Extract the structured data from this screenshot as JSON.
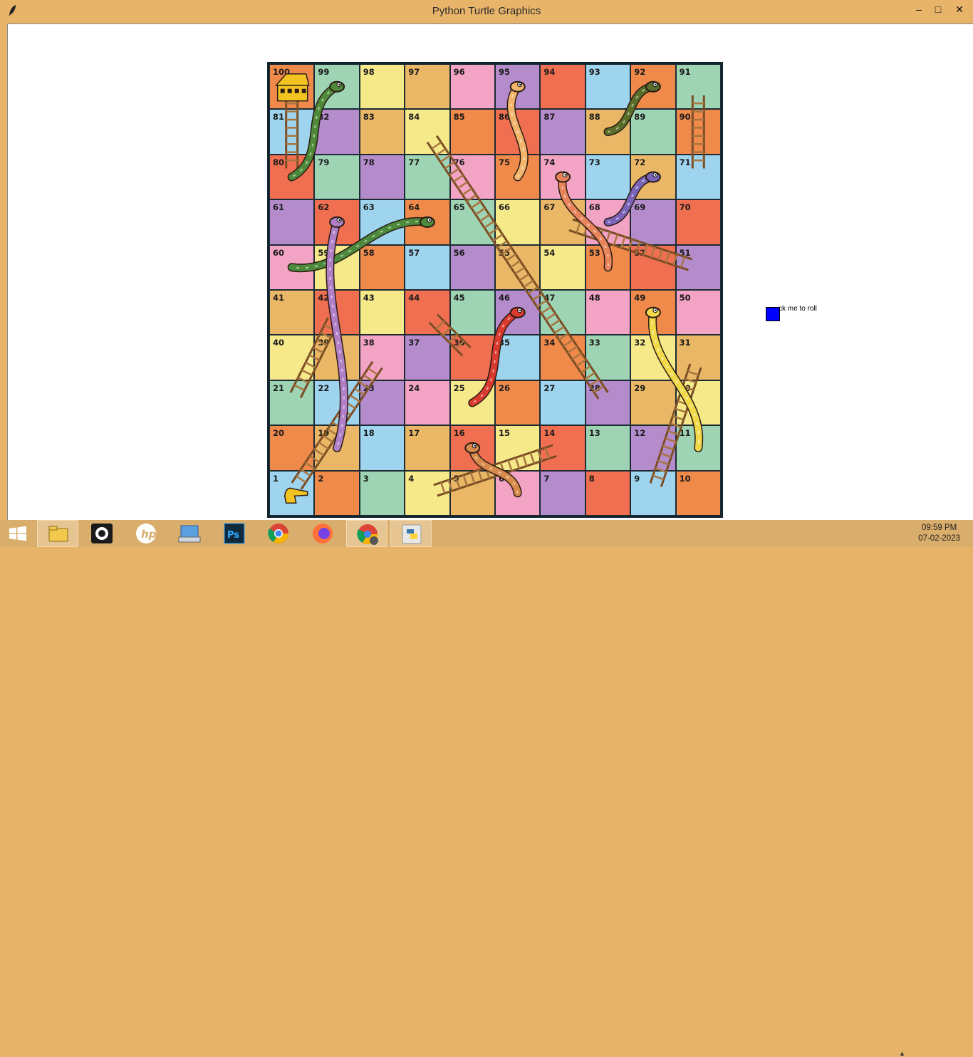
{
  "window": {
    "title": "Python Turtle Graphics",
    "minimize_glyph": "–",
    "maximize_glyph": "□",
    "close_glyph": "✕"
  },
  "roll_button": {
    "label": "ck me to roll",
    "color": "#0000ff"
  },
  "board": {
    "rows": [
      [
        100,
        99,
        98,
        97,
        96,
        95,
        94,
        93,
        92,
        91
      ],
      [
        81,
        82,
        83,
        84,
        85,
        86,
        87,
        88,
        89,
        90
      ],
      [
        80,
        79,
        78,
        77,
        76,
        75,
        74,
        73,
        72,
        71
      ],
      [
        61,
        62,
        63,
        64,
        65,
        66,
        67,
        68,
        69,
        70
      ],
      [
        60,
        59,
        58,
        57,
        56,
        55,
        54,
        53,
        52,
        51
      ],
      [
        41,
        42,
        43,
        44,
        45,
        46,
        47,
        48,
        49,
        50
      ],
      [
        40,
        39,
        38,
        37,
        36,
        35,
        34,
        33,
        32,
        31
      ],
      [
        21,
        22,
        23,
        24,
        25,
        26,
        27,
        28,
        29,
        30
      ],
      [
        20,
        19,
        18,
        17,
        16,
        15,
        14,
        13,
        12,
        11
      ],
      [
        1,
        2,
        3,
        4,
        5,
        6,
        7,
        8,
        9,
        10
      ]
    ],
    "palette": [
      "#f08a4b",
      "#b48ccc",
      "#f6e98a",
      "#9fd4ef",
      "#f3a3c3",
      "#9ed4b4",
      "#f06f50",
      "#e9b766"
    ],
    "ladders": [
      {
        "from": 1,
        "to": 38
      },
      {
        "from": 4,
        "to": 14
      },
      {
        "from": 9,
        "to": 31
      },
      {
        "from": 21,
        "to": 42
      },
      {
        "from": 28,
        "to": 84
      },
      {
        "from": 36,
        "to": 44
      },
      {
        "from": 51,
        "to": 67
      },
      {
        "from": 71,
        "to": 91
      },
      {
        "from": 80,
        "to": 100
      }
    ],
    "snakes": [
      {
        "head": 99,
        "tail": 80,
        "color": "#4f8a3a"
      },
      {
        "head": 95,
        "tail": 75,
        "color": "#f3b46b"
      },
      {
        "head": 92,
        "tail": 88,
        "color": "#5a6e2a"
      },
      {
        "head": 74,
        "tail": 53,
        "color": "#e8845a"
      },
      {
        "head": 72,
        "tail": 68,
        "color": "#7b64b8"
      },
      {
        "head": 64,
        "tail": 60,
        "color": "#4d8a3c"
      },
      {
        "head": 62,
        "tail": 19,
        "color": "#b07fc6"
      },
      {
        "head": 46,
        "tail": 25,
        "color": "#d83a2e"
      },
      {
        "head": 49,
        "tail": 11,
        "color": "#f1d94a"
      },
      {
        "head": 16,
        "tail": 6,
        "color": "#d78a4a"
      }
    ]
  },
  "player": {
    "position": 1,
    "color": "#ff0000"
  },
  "taskbar": {
    "apps": [
      {
        "name": "file-explorer-icon"
      },
      {
        "name": "camera-app-icon"
      },
      {
        "name": "hp-icon"
      },
      {
        "name": "keyboard-icon"
      },
      {
        "name": "photoshop-icon"
      },
      {
        "name": "chrome-icon"
      },
      {
        "name": "firefox-icon"
      },
      {
        "name": "chrome-profile-icon"
      },
      {
        "name": "python-icon"
      }
    ],
    "time": "09:59 PM",
    "date": "07-02-2023"
  }
}
